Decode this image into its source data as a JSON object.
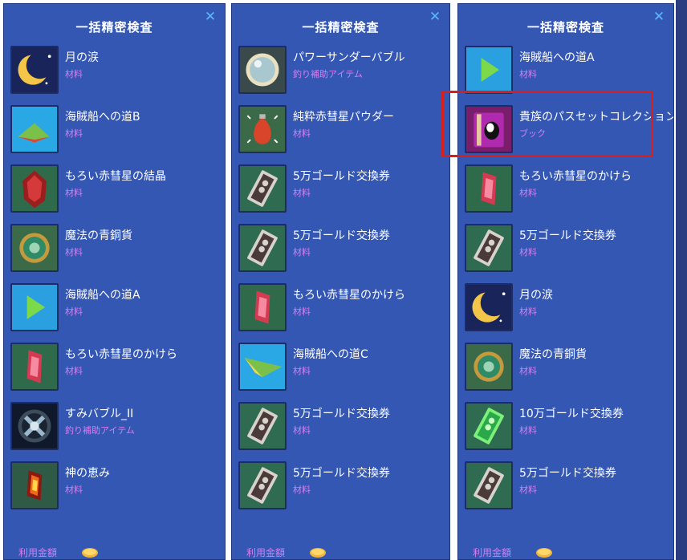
{
  "panels": [
    {
      "title": "一括精密検査",
      "close": "✕",
      "footer_label": "利用金額",
      "items": [
        {
          "name": "月の涙",
          "category": "材料",
          "icon": "moon-icon"
        },
        {
          "name": "海賊船への道B",
          "category": "材料",
          "icon": "map-fragment-icon"
        },
        {
          "name": "もろい赤彗星の結晶",
          "category": "材料",
          "icon": "red-crystal-icon"
        },
        {
          "name": "魔法の青銅貨",
          "category": "材料",
          "icon": "bronze-coin-icon"
        },
        {
          "name": "海賊船への道A",
          "category": "材料",
          "icon": "play-arrow-icon"
        },
        {
          "name": "もろい赤彗星のかけら",
          "category": "材料",
          "icon": "red-shard-icon"
        },
        {
          "name": "すみバブル_II",
          "category": "釣り補助アイテム",
          "icon": "ink-bubble-icon"
        },
        {
          "name": "神の恵み",
          "category": "材料",
          "icon": "blessing-icon"
        }
      ]
    },
    {
      "title": "一括精密検査",
      "close": "✕",
      "footer_label": "利用金額",
      "items": [
        {
          "name": "パワーサンダーバブル",
          "category": "釣り補助アイテム",
          "icon": "bubble-icon"
        },
        {
          "name": "純粋赤彗星パウダー",
          "category": "材料",
          "icon": "powder-pouch-icon"
        },
        {
          "name": "5万ゴールド交換券",
          "category": "材料",
          "icon": "gold-ticket-icon"
        },
        {
          "name": "5万ゴールド交換券",
          "category": "材料",
          "icon": "gold-ticket-icon"
        },
        {
          "name": "もろい赤彗星のかけら",
          "category": "材料",
          "icon": "red-shard-icon"
        },
        {
          "name": "海賊船への道C",
          "category": "材料",
          "icon": "map-fragment-icon"
        },
        {
          "name": "5万ゴールド交換券",
          "category": "材料",
          "icon": "gold-ticket-icon"
        },
        {
          "name": "5万ゴールド交換券",
          "category": "材料",
          "icon": "gold-ticket-icon"
        }
      ]
    },
    {
      "title": "一括精密検査",
      "close": "✕",
      "footer_label": "利用金額",
      "items": [
        {
          "name": "海賊船への道A",
          "category": "材料",
          "icon": "play-arrow-icon"
        },
        {
          "name": "貴族のパスセットコレクション",
          "category": "ブック",
          "icon": "book-icon"
        },
        {
          "name": "もろい赤彗星のかけら",
          "category": "材料",
          "icon": "red-shard-icon"
        },
        {
          "name": "5万ゴールド交換券",
          "category": "材料",
          "icon": "gold-ticket-icon"
        },
        {
          "name": "月の涙",
          "category": "材料",
          "icon": "moon-icon"
        },
        {
          "name": "魔法の青銅貨",
          "category": "材料",
          "icon": "bronze-coin-icon"
        },
        {
          "name": "10万ゴールド交換券",
          "category": "材料",
          "icon": "green-ticket-icon"
        },
        {
          "name": "5万ゴールド交換券",
          "category": "材料",
          "icon": "gold-ticket-icon"
        }
      ]
    }
  ],
  "colors": {
    "panel_bg": "#3457b4",
    "category_text": "#d57ff0",
    "highlight": "#d61f1f"
  }
}
